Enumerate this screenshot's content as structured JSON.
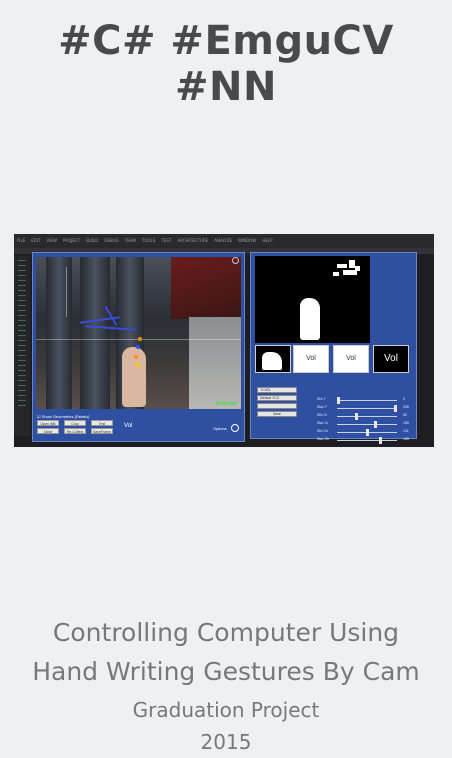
{
  "header": {
    "tags": "#C# #EmguCV #NN"
  },
  "screenshot": {
    "menu_items": [
      "FILE",
      "EDIT",
      "VIEW",
      "PROJECT",
      "BUILD",
      "DEBUG",
      "TEAM",
      "TOOLS",
      "TEST",
      "ARCHITECTURE",
      "ANALYZE",
      "WINDOW",
      "HELP"
    ],
    "preview_window": {
      "status_label": "Detected",
      "show_geometries_label": "Show Geometries (Retails)",
      "buttons": [
        "Open WB",
        "Crop",
        "Test",
        "Clear",
        "Re-Collect",
        "SaveFrame"
      ],
      "gesture_label": "Vol",
      "options_label": "Options"
    },
    "processing_window": {
      "thumb_text_1": "Vol",
      "thumb_text_2": "Vol",
      "thumb_text_dark": "Vol",
      "color_mode": "YCrCb",
      "detect_mode": "Default YCC",
      "save_label": "Save",
      "sliders": [
        {
          "name": "Min Y",
          "value": "0",
          "level": 0.0
        },
        {
          "name": "Max Y",
          "value": "255",
          "level": 1.0
        },
        {
          "name": "Min Cr",
          "value": "80",
          "level": 0.31
        },
        {
          "name": "Max Cr",
          "value": "165",
          "level": 0.65
        },
        {
          "name": "Min Cb",
          "value": "131",
          "level": 0.51
        },
        {
          "name": "Max Cb",
          "value": "185",
          "level": 0.73
        }
      ]
    },
    "colors": {
      "window_blue": "#2f4fa0",
      "ide_dark": "#1e1e22",
      "ink": "#3a4bd8"
    }
  },
  "footer": {
    "title_line1": "Controlling Computer Using",
    "title_line2": "Hand Writing Gestures By Cam",
    "subtitle": "Graduation Project",
    "year": "2015"
  }
}
